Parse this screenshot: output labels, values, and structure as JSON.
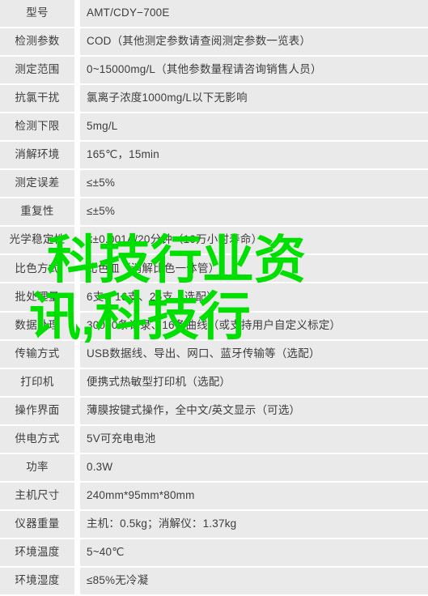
{
  "table": {
    "rows": [
      {
        "label": "型号",
        "value": "AMT/CDY−700E"
      },
      {
        "label": "检测参数",
        "value": "COD（其他测定参数请查阅测定参数一览表）"
      },
      {
        "label": "测定范围",
        "value": "0~15000mg/L（其他参数量程请咨询销售人员）"
      },
      {
        "label": "抗氯干扰",
        "value": "氯离子浓度1000mg/L以下无影响"
      },
      {
        "label": "检测下限",
        "value": "5mg/L"
      },
      {
        "label": "消解环境",
        "value": "165℃，15min"
      },
      {
        "label": "测定误差",
        "value": "≤±5%"
      },
      {
        "label": "重复性",
        "value": "≤±5%"
      },
      {
        "label": "光学稳定性",
        "value": "≤±0.001A/20分钟（10万小时寿命）"
      },
      {
        "label": "比色方式",
        "value": "比色皿（消解比色一体管）"
      },
      {
        "label": "批处理量",
        "value": "6支、16支、25支（选配）"
      },
      {
        "label": "数据处理",
        "value": "30000条记录、16条曲线（或支持用户自定义标定）"
      },
      {
        "label": "传输方式",
        "value": "USB数据线、导出、网口、蓝牙传输等（选配）"
      },
      {
        "label": "打印机",
        "value": "便携式热敏型打印机（选配）"
      },
      {
        "label": "操作界面",
        "value": "薄膜按键式操作，全中文/英文显示（可选）"
      },
      {
        "label": "供电方式",
        "value": "5V可充电电池"
      },
      {
        "label": "功率",
        "value": "0.3W"
      },
      {
        "label": "主机尺寸",
        "value": "240mm*95mm*80mm"
      },
      {
        "label": "仪器重量",
        "value": "主机：0.5kg；消解仪：1.37kg"
      },
      {
        "label": "环境温度",
        "value": "5~40℃"
      },
      {
        "label": "环境湿度",
        "value": "≤85%无冷凝"
      }
    ]
  },
  "watermark": {
    "line1": "科技行业资",
    "line2": "讯,科技行",
    "color": "#00e000"
  }
}
